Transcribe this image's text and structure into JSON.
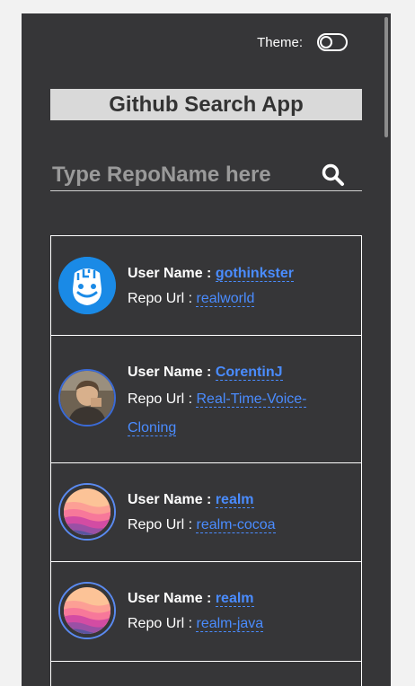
{
  "header": {
    "theme_label": "Theme:",
    "title": "Github Search App"
  },
  "search": {
    "placeholder": "Type RepoName here",
    "value": ""
  },
  "labels": {
    "user_name": "User Name :",
    "repo_url": "Repo Url :"
  },
  "results": [
    {
      "user": "gothinkster",
      "repo": "realworld",
      "avatar_icon": "brain-face-logo-icon"
    },
    {
      "user": "CorentinJ",
      "repo": "Real-Time-Voice-Cloning",
      "avatar_icon": "person-photo-icon"
    },
    {
      "user": "realm",
      "repo": "realm-cocoa",
      "avatar_icon": "realm-logo-icon"
    },
    {
      "user": "realm",
      "repo": "realm-java",
      "avatar_icon": "realm-logo-icon"
    }
  ],
  "colors": {
    "background": "#363638",
    "title_bar": "#d9d9d9",
    "link": "#4a8cff"
  }
}
